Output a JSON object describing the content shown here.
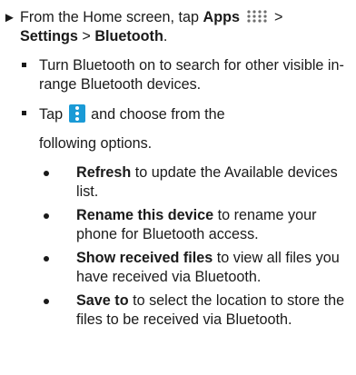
{
  "step": {
    "marker": "►",
    "text_prefix": "From the Home screen, tap ",
    "apps_label": "Apps",
    "sep1": " > ",
    "settings_label": "Settings",
    "sep2": " > ",
    "bluetooth_label": "Bluetooth",
    "suffix": "."
  },
  "bullets": [
    {
      "text": "Turn Bluetooth on to search for other visible in-range Bluetooth devices."
    }
  ],
  "tap_bullet": {
    "prefix": "Tap ",
    "suffix": " and choose from the",
    "line2": "following options."
  },
  "options": [
    {
      "bold": "Refresh",
      "rest": " to update the Available devices list."
    },
    {
      "bold": "Rename this device",
      "rest": " to rename your phone for Bluetooth access."
    },
    {
      "bold": "Show received files",
      "rest": " to view all files you have received via Bluetooth."
    },
    {
      "bold": "Save to",
      "rest": " to select the location to store the files to be received via Bluetooth."
    }
  ],
  "icons": {
    "apps": "apps-grid-icon",
    "menu": "more-options-icon",
    "menu_color": "#1a9ad6"
  }
}
